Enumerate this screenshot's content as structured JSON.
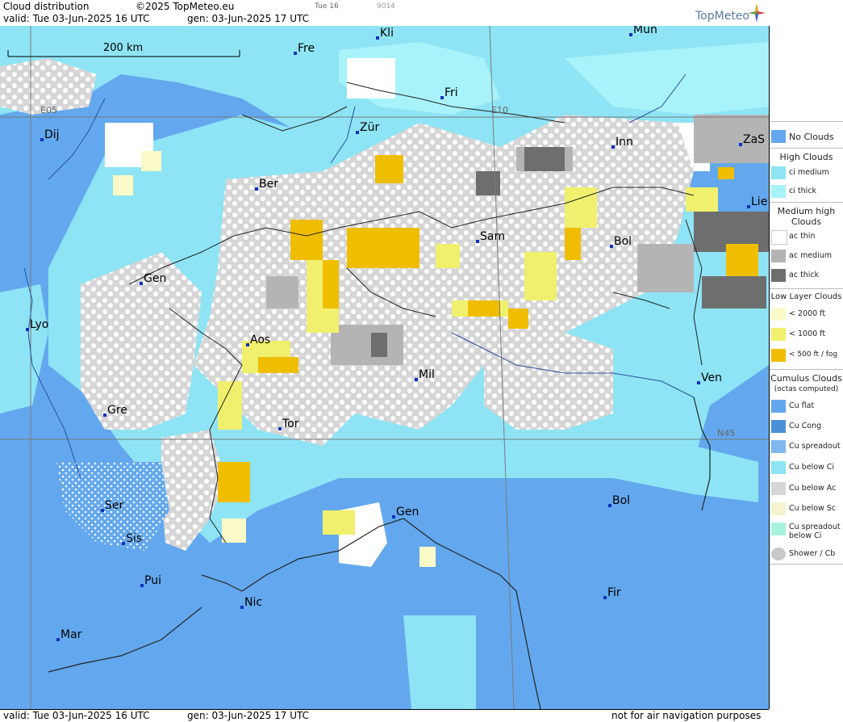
{
  "header": {
    "title": "Cloud distribution",
    "copyright": "©2025 TopMeteo.eu",
    "valid": "valid:  Tue  03-Jun-2025  16 UTC",
    "gen": "gen: 03-Jun-2025 17 UTC",
    "small_a": "Tue 16",
    "small_b": "9014",
    "brand": "TopMeteo"
  },
  "footer": {
    "valid": "valid:  Tue  03-Jun-2025  16 UTC",
    "gen": "gen: 03-Jun-2025 17 UTC",
    "note": "not for air navigation purposes"
  },
  "map": {
    "scale_label": "200 km",
    "grid_labels": [
      "E05",
      "E10",
      "N45"
    ],
    "cities": [
      "Kli",
      "Mun",
      "Fre",
      "Fri",
      "Dij",
      "Zür",
      "Inn",
      "ZaS",
      "Ber",
      "Lie",
      "Sam",
      "Bol",
      "Gen",
      "Lyo",
      "Aos",
      "Mil",
      "Ven",
      "Gre",
      "Tor",
      "Ser",
      "Gen",
      "Bol",
      "Sis",
      "Pui",
      "Nic",
      "Fir",
      "Mar"
    ]
  },
  "legend": {
    "no_clouds": "No Clouds",
    "high_title": "High Clouds",
    "ci_medium": "ci medium",
    "ci_thick": "ci thick",
    "medium_title": "Medium high Clouds",
    "ac_thin": "ac thin",
    "ac_medium": "ac medium",
    "ac_thick": "ac thick",
    "low_title": "Low Layer Clouds",
    "low_2000": "< 2000 ft",
    "low_1000": "< 1000 ft",
    "low_500": "< 500 ft / fog",
    "cu_title": "Cumulus Clouds",
    "cu_sub": "(octas computed)",
    "cu_flat": "Cu flat",
    "cu_cong": "Cu Cong",
    "cu_spreadout": "Cu spreadout",
    "cu_below_ci": "Cu below Ci",
    "cu_below_ac": "Cu below Ac",
    "cu_below_sc": "Cu below Sc",
    "cu_spreadout_below_ci": "Cu spreadout below Ci",
    "shower": "Shower / Cb"
  },
  "colors": {
    "no_clouds": "#63a8ee",
    "ci_medium": "#8ee4f4",
    "ci_thick": "#a8f2fa",
    "ac_thin": "#ffffff",
    "ac_medium": "#b4b4b4",
    "ac_thick": "#6e6e6e",
    "low_2000": "#fafac8",
    "low_1000": "#f0f06e",
    "low_500": "#f0be00"
  }
}
